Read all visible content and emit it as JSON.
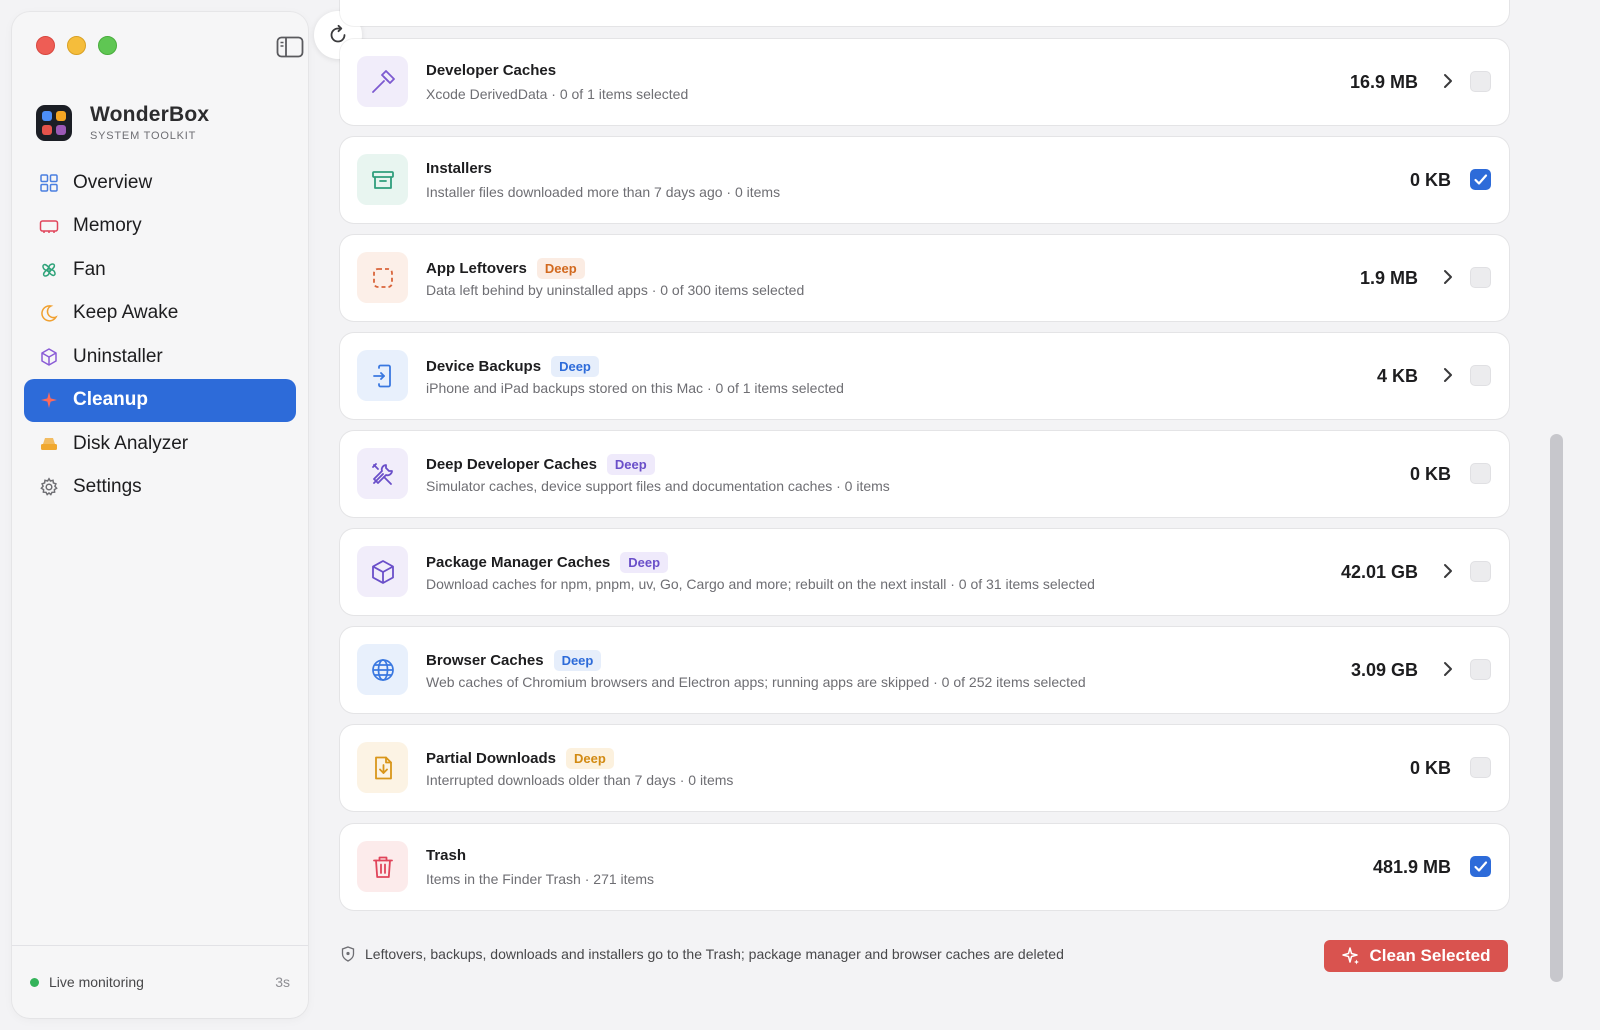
{
  "app": {
    "name": "WonderBox",
    "subtitle": "SYSTEM TOOLKIT"
  },
  "sidebar": {
    "items": [
      {
        "label": "Overview",
        "icon": "grid-icon",
        "active": false
      },
      {
        "label": "Memory",
        "icon": "memory-icon",
        "active": false
      },
      {
        "label": "Fan",
        "icon": "fan-icon",
        "active": false
      },
      {
        "label": "Keep Awake",
        "icon": "moon-icon",
        "active": false
      },
      {
        "label": "Uninstaller",
        "icon": "cube-icon",
        "active": false
      },
      {
        "label": "Cleanup",
        "icon": "sparkle-icon",
        "active": true
      },
      {
        "label": "Disk Analyzer",
        "icon": "disk-icon",
        "active": false
      },
      {
        "label": "Settings",
        "icon": "gear-icon",
        "active": false
      }
    ],
    "footer": {
      "label": "Live monitoring",
      "interval": "3s"
    }
  },
  "cleanup": {
    "items": [
      {
        "title": "Developer Caches",
        "badge": "",
        "subtitle": "Xcode DerivedData · 0 of 1 items selected",
        "size": "16.9 MB",
        "has_detail": true,
        "checked": false,
        "icon": "hammer-icon"
      },
      {
        "title": "Installers",
        "badge": "",
        "subtitle": "Installer files downloaded more than 7 days ago · 0 items",
        "size": "0 KB",
        "has_detail": false,
        "checked": true,
        "icon": "archive-icon"
      },
      {
        "title": "App Leftovers",
        "badge": "Deep",
        "subtitle": "Data left behind by uninstalled apps · 0 of 300 items selected",
        "size": "1.9 MB",
        "has_detail": true,
        "checked": false,
        "icon": "dashed-square-icon"
      },
      {
        "title": "Device Backups",
        "badge": "Deep",
        "subtitle": "iPhone and iPad backups stored on this Mac · 0 of 1 items selected",
        "size": "4 KB",
        "has_detail": true,
        "checked": false,
        "icon": "device-backup-icon"
      },
      {
        "title": "Deep Developer Caches",
        "badge": "Deep",
        "subtitle": "Simulator caches, device support files and documentation caches · 0 items",
        "size": "0 KB",
        "has_detail": false,
        "checked": false,
        "icon": "tools-icon"
      },
      {
        "title": "Package Manager Caches",
        "badge": "Deep",
        "subtitle": "Download caches for npm, pnpm, uv, Go, Cargo and more; rebuilt on the next install · 0 of 31 items selected",
        "size": "42.01 GB",
        "has_detail": true,
        "checked": false,
        "icon": "package-icon"
      },
      {
        "title": "Browser Caches",
        "badge": "Deep",
        "subtitle": "Web caches of Chromium browsers and Electron apps; running apps are skipped · 0 of 252 items selected",
        "size": "3.09 GB",
        "has_detail": true,
        "checked": false,
        "icon": "globe-icon"
      },
      {
        "title": "Partial Downloads",
        "badge": "Deep",
        "subtitle": "Interrupted downloads older than 7 days · 0 items",
        "size": "0 KB",
        "has_detail": false,
        "checked": false,
        "icon": "download-file-icon"
      },
      {
        "title": "Trash",
        "badge": "",
        "subtitle": "Items in the Finder Trash · 271 items",
        "size": "481.9 MB",
        "has_detail": false,
        "checked": true,
        "icon": "trash-icon"
      }
    ],
    "footer_note": "Leftovers, backups, downloads and installers go to the Trash; package manager and browser caches are deleted",
    "clean_button": "Clean Selected"
  },
  "colors": {
    "accent": "#2d6bd9",
    "danger": "#d9534f",
    "badge_orange": "#d2691e",
    "badge_blue": "#2d6bd9",
    "badge_purple": "#6a4fc9",
    "badge_amber": "#d28a12"
  }
}
